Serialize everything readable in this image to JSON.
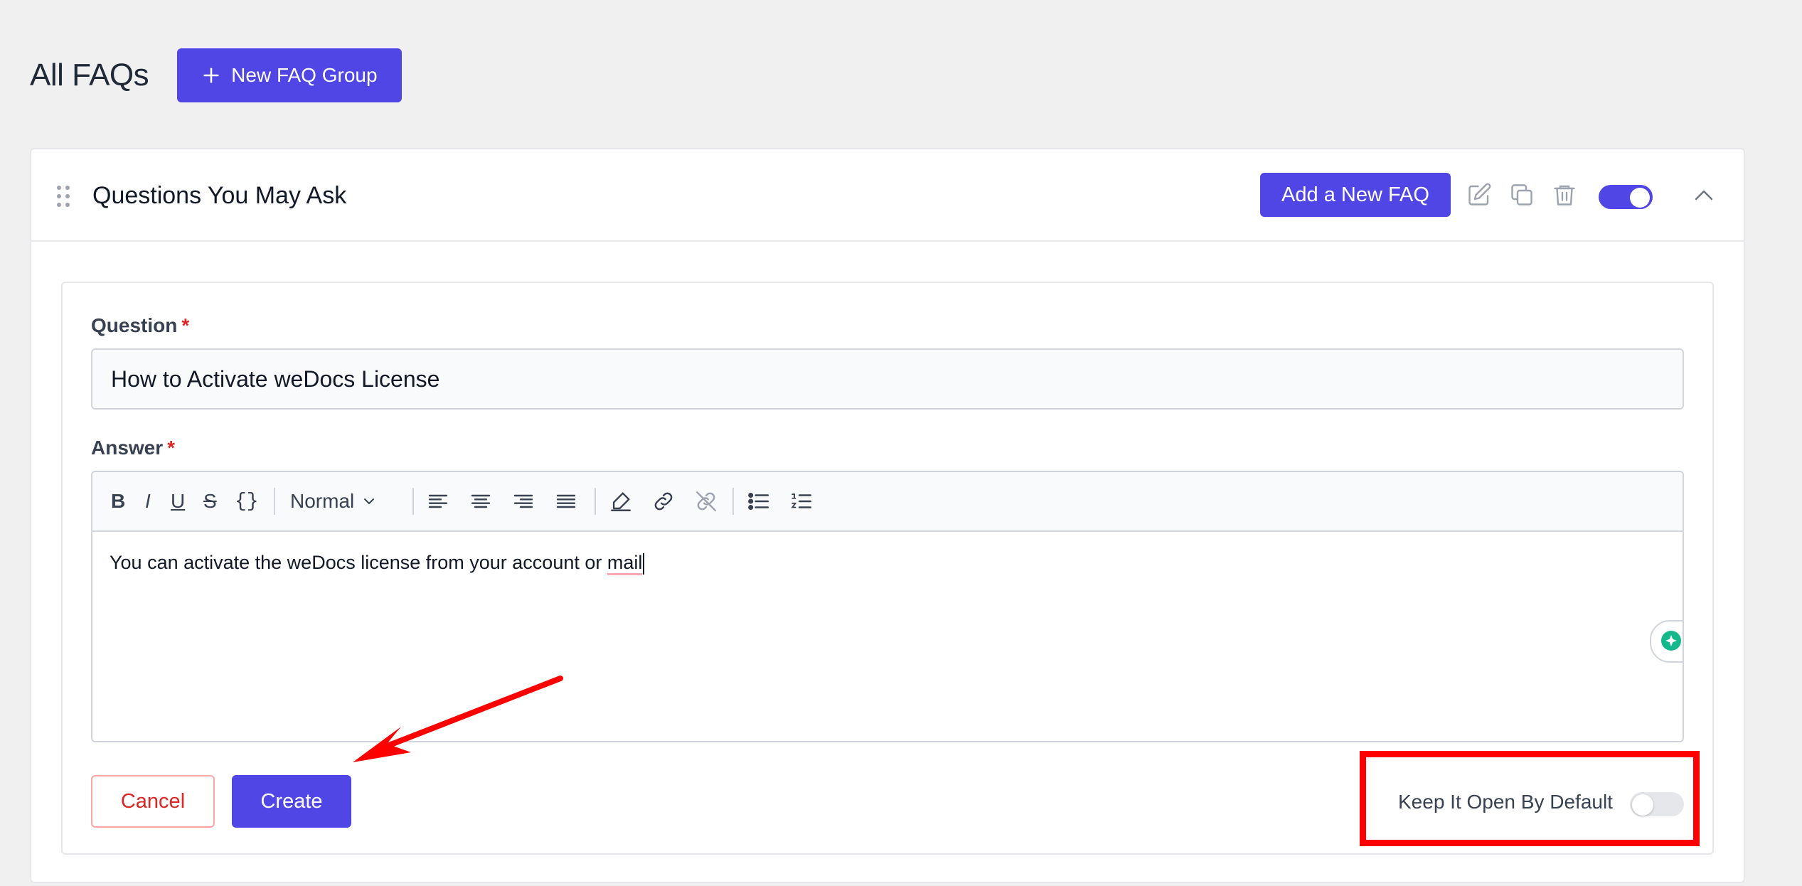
{
  "header": {
    "title": "All FAQs",
    "new_group_label": "New FAQ Group"
  },
  "group": {
    "title": "Questions You May Ask",
    "add_faq_label": "Add a New FAQ",
    "enabled": true
  },
  "form": {
    "question_label": "Question",
    "answer_label": "Answer",
    "required_mark": "*",
    "question_value": "How to Activate weDocs License",
    "answer_text_before": "You can activate the weDocs license from your account or ",
    "answer_text_misspelled": "mail",
    "format_select": "Normal",
    "toolbar": {
      "bold": "B",
      "italic": "I",
      "underline": "U",
      "strike": "S",
      "code": "{}"
    },
    "cancel_label": "Cancel",
    "create_label": "Create",
    "keep_open_label": "Keep It Open By Default",
    "keep_open": false
  },
  "colors": {
    "primary": "#4f46e5",
    "danger": "#dc2626",
    "annotation": "#ff0000"
  }
}
